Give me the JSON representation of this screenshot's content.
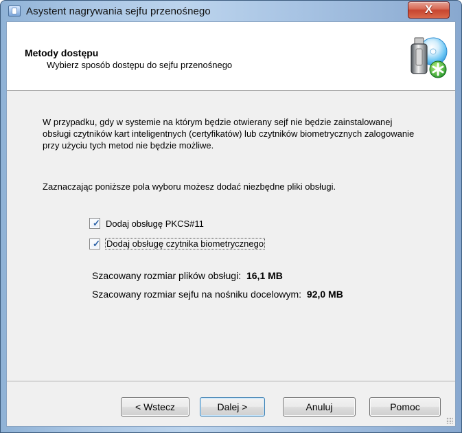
{
  "window": {
    "title": "Asystent nagrywania sejfu przenośnego",
    "close_label": "X",
    "icon": "wizard-window-icon"
  },
  "header": {
    "title": "Metody dostępu",
    "subtitle": "Wybierz sposób dostępu do sejfu przenośnego",
    "graphic_icon": "portable-safe-wizard-icon"
  },
  "content": {
    "paragraph_1": "W przypadku, gdy w systemie na którym będzie otwierany sejf nie będzie zainstalowanej obsługi czytników kart inteligentnych (certyfikatów) lub czytników biometrycznych zalogowanie przy użyciu tych metod nie będzie możliwe.",
    "paragraph_2": "Zaznaczając poniższe pola wyboru możesz dodać niezbędne pliki obsługi.",
    "checkboxes": [
      {
        "label": "Dodaj obsługę PKCS#11",
        "checked": true,
        "mark": "✓"
      },
      {
        "label": "Dodaj obsługę czytnika biometrycznego",
        "checked": true,
        "mark": "✓"
      }
    ],
    "estimates": {
      "support_files_label": "Szacowany rozmiar plików obsługi:",
      "support_files_value": "16,1 MB",
      "target_label": "Szacowany rozmiar sejfu na nośniku docelowym:",
      "target_value": "92,0 MB"
    }
  },
  "buttons": {
    "back": "< Wstecz",
    "next": "Dalej >",
    "cancel": "Anuluj",
    "help": "Pomoc"
  },
  "colors": {
    "title_bar": "#a9c6e6",
    "close_button": "#c74530",
    "dialog_background": "#f0f0f0",
    "header_background": "#ffffff",
    "checkbox_accent": "#2d63a7"
  }
}
